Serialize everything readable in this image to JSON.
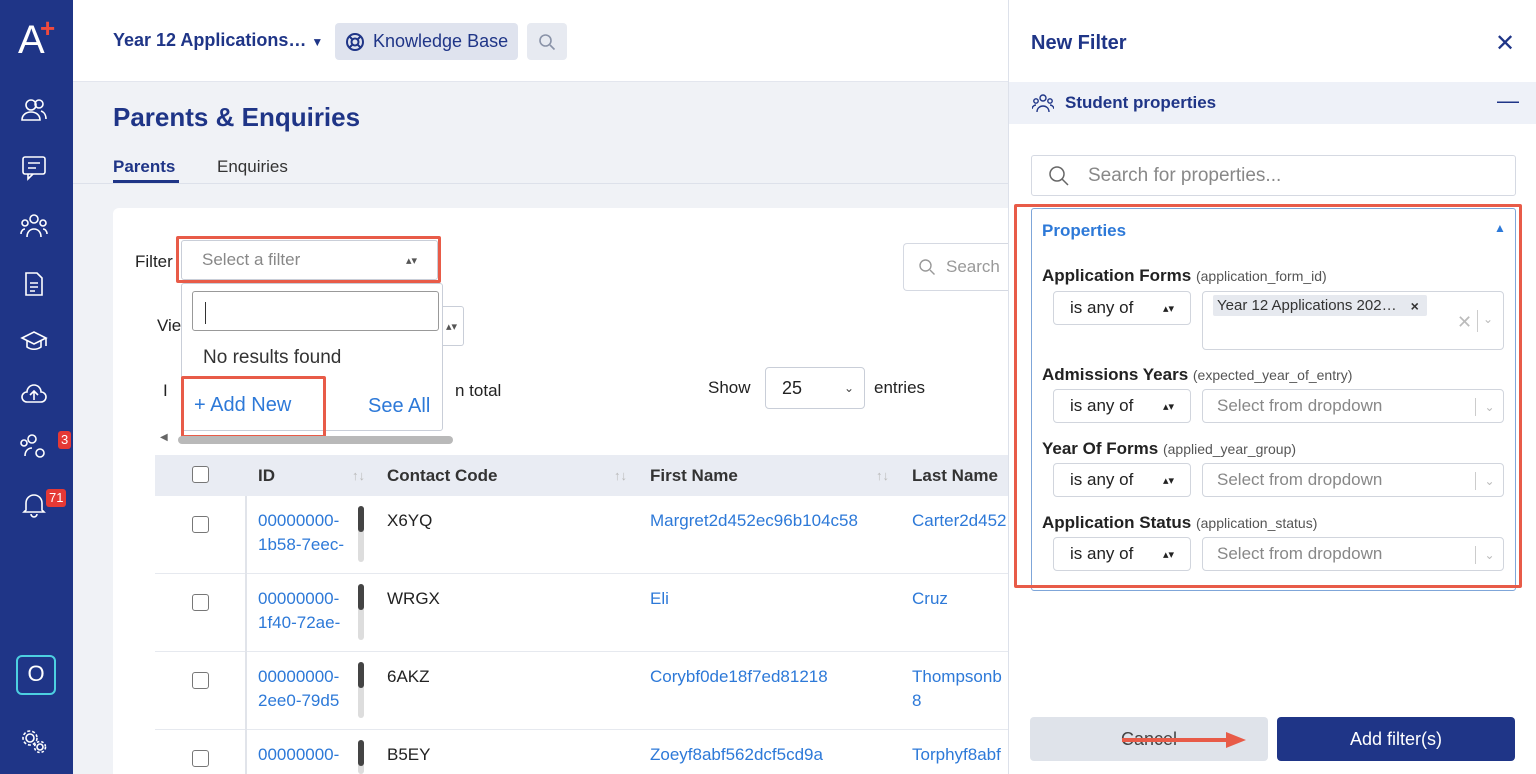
{
  "colors": {
    "brand": "#1f3587",
    "link": "#2d79d8",
    "highlight": "#e85b48",
    "badge": "#e53935"
  },
  "sidebar": {
    "logo": "A",
    "logo_plus": "+",
    "items": [
      {
        "icon": "users-icon"
      },
      {
        "icon": "chat-icon"
      },
      {
        "icon": "group-icon"
      },
      {
        "icon": "document-icon"
      },
      {
        "icon": "graduation-cap-icon"
      },
      {
        "icon": "cloud-upload-icon"
      },
      {
        "icon": "group-settings-icon",
        "badge": "3"
      },
      {
        "icon": "bell-icon",
        "badge": "71"
      }
    ],
    "bottom_box": "O",
    "settings_icon": "gears-icon"
  },
  "topbar": {
    "app_name": "Year 12 Applications…",
    "kb_label": "Knowledge Base"
  },
  "page": {
    "title": "Parents & Enquiries",
    "tabs": [
      {
        "label": "Parents",
        "active": true
      },
      {
        "label": "Enquiries",
        "active": false
      }
    ]
  },
  "filters": {
    "label": "Filter",
    "placeholder": "Select a filter",
    "view_label": "Vie",
    "dropdown": {
      "no_results": "No results found",
      "add_new": "+ Add New",
      "see_all": "See All"
    },
    "total_fragment": "n total",
    "stub": "I",
    "search_placeholder": "Search"
  },
  "entries": {
    "show": "Show",
    "value": "25",
    "label": "entries"
  },
  "table": {
    "columns": [
      "ID",
      "Contact Code",
      "First Name",
      "Last Name"
    ],
    "rows": [
      {
        "id1": "00000000-",
        "id2": "1b58-7eec-",
        "code": "X6YQ",
        "first": "Margret2d452ec96b104c58",
        "last": "Carter2d452"
      },
      {
        "id1": "00000000-",
        "id2": "1f40-72ae-",
        "code": "WRGX",
        "first": "Eli",
        "last": "Cruz"
      },
      {
        "id1": "00000000-",
        "id2": "2ee0-79d5",
        "code": "6AKZ",
        "first": "Corybf0de18f7ed81218",
        "last": "Thompsonb",
        "last2": "8"
      },
      {
        "id1": "00000000-",
        "id2": "",
        "code": "B5EY",
        "first": "Zoeyf8abf562dcf5cd9a",
        "last": "Torphyf8abf"
      }
    ]
  },
  "panel": {
    "title": "New Filter",
    "section": "Student properties",
    "search_placeholder": "Search for properties...",
    "props_title": "Properties",
    "properties": [
      {
        "label": "Application Forms",
        "key": "(application_form_id)",
        "op": "is any of",
        "chip": "Year 12 Applications 202…"
      },
      {
        "label": "Admissions Years",
        "key": "(expected_year_of_entry)",
        "op": "is any of",
        "placeholder": "Select from dropdown"
      },
      {
        "label": "Year Of Forms",
        "key": "(applied_year_group)",
        "op": "is any of",
        "placeholder": "Select from dropdown"
      },
      {
        "label": "Application Status",
        "key": "(application_status)",
        "op": "is any of",
        "placeholder": "Select from dropdown"
      }
    ],
    "cancel": "Cancel",
    "add": "Add filter(s)"
  }
}
